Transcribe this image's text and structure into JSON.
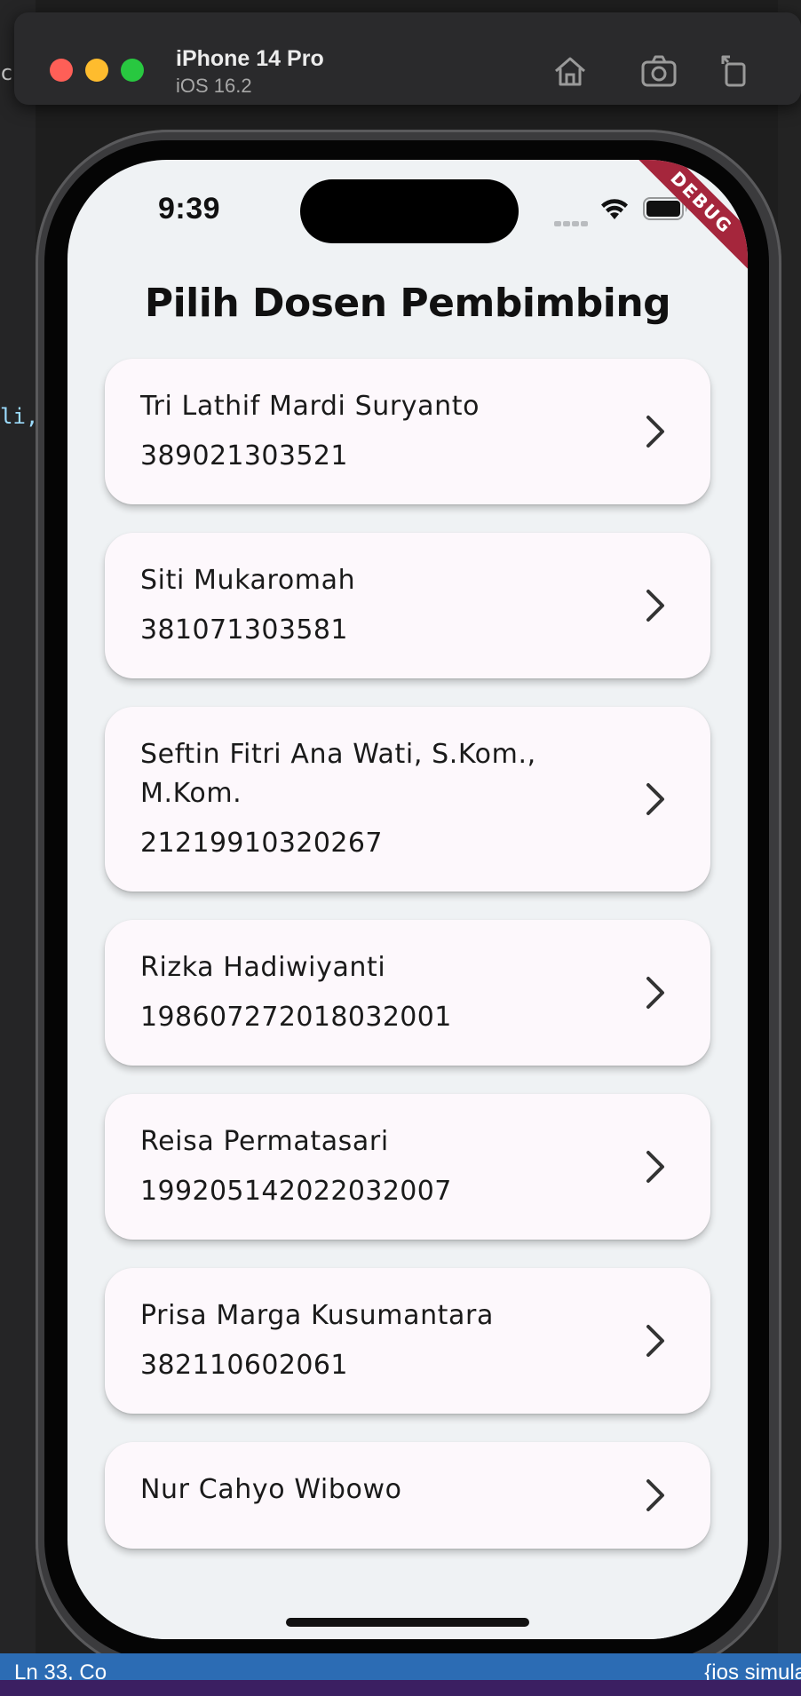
{
  "simulator": {
    "device_name": "iPhone 14 Pro",
    "os_version": "iOS 16.2"
  },
  "ide": {
    "status_left": "Ln 33, Co",
    "status_right": "{ios simula",
    "code_fragment": "li,",
    "code_fragment2": "co"
  },
  "status_bar": {
    "time": "9:39"
  },
  "debug_banner": "DEBUG",
  "page": {
    "title": "Pilih Dosen Pembimbing"
  },
  "lecturers": [
    {
      "name": "Tri Lathif Mardi Suryanto",
      "nip": "389021303521"
    },
    {
      "name": "Siti Mukaromah",
      "nip": "381071303581"
    },
    {
      "name": "Seftin Fitri Ana Wati, S.Kom., M.Kom.",
      "nip": "21219910320267"
    },
    {
      "name": "Rizka Hadiwiyanti",
      "nip": "198607272018032001"
    },
    {
      "name": "Reisa Permatasari",
      "nip": "199205142022032007"
    },
    {
      "name": "Prisa Marga Kusumantara",
      "nip": "382110602061"
    },
    {
      "name": "Nur Cahyo Wibowo",
      "nip": ""
    }
  ],
  "icons": {
    "home": "home-icon",
    "screenshot": "camera-icon",
    "rotate": "rotate-icon",
    "chevron": "chevron-right-icon",
    "wifi": "wifi-icon",
    "battery": "battery-icon"
  },
  "colors": {
    "screen_background": "#eff2f4",
    "card_background": "#fdf8fc",
    "debug_banner": "#a5263c",
    "ide_statusbar": "#2c6cb4"
  }
}
